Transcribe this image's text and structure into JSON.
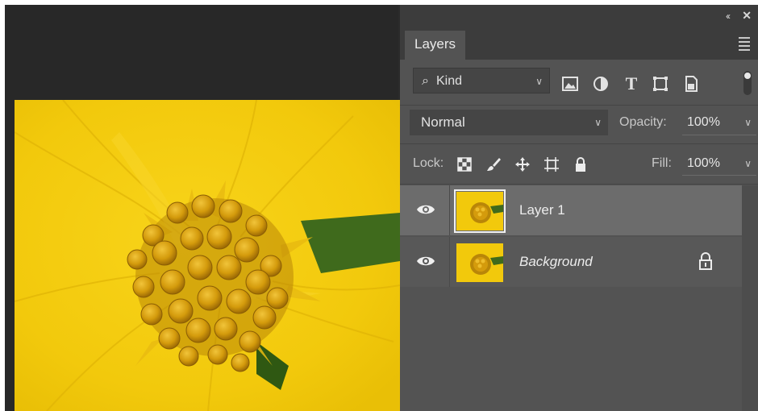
{
  "panel": {
    "collapse_glyph": "‹‹",
    "close_glyph": "✕",
    "tab_label": "Layers",
    "menu_icon": "hamburger-menu-icon"
  },
  "filter": {
    "kind_label": "Kind",
    "kind_search_icon": "search-icon",
    "filter_icons": [
      "pixel-layer-filter-icon",
      "adjustment-layer-filter-icon",
      "type-layer-filter-icon",
      "shape-layer-filter-icon",
      "smart-object-filter-icon"
    ],
    "type_glyph": "T"
  },
  "blend": {
    "mode": "Normal",
    "opacity_label": "Opacity:",
    "opacity_value": "100%"
  },
  "lock": {
    "label": "Lock:",
    "fill_label": "Fill:",
    "fill_value": "100%"
  },
  "layers": [
    {
      "name": "Layer 1",
      "visible": true,
      "selected": true,
      "locked": false
    },
    {
      "name": "Background",
      "visible": true,
      "selected": false,
      "locked": true
    }
  ],
  "colors": {
    "panel_bg": "#535353",
    "selected_row": "#6c6c6c",
    "canvas_bg": "#282828",
    "flower_yellow": "#f5cf10",
    "flower_center": "#d49b0c"
  }
}
